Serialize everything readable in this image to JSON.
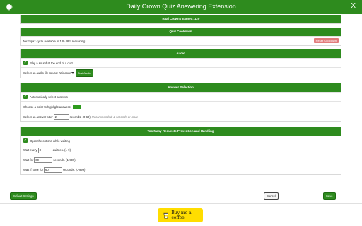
{
  "header": {
    "title": "Daily Crown Quiz Answering Extension",
    "close_label": "X"
  },
  "total_crowns": {
    "label": "Total Crowns Earned: 120"
  },
  "quiz_cooldown": {
    "heading": "Quiz Cooldown",
    "status_text": "Next quiz cycle available in 18h 48m remaining",
    "reset_label": "Reset Cooldown"
  },
  "audio": {
    "heading": "Audio",
    "play_sound_label": "Play a sound at the end of a quiz",
    "select_file_label": "Select an audio file to use:",
    "selected_file": "Windows",
    "test_label": "Test Audio"
  },
  "answer_selection": {
    "heading": "Answer Selection",
    "auto_select_label": "Automatically select answers",
    "color_label": "Choose a color to highlight answers:",
    "highlight_color": "#2e9b1e",
    "after_prefix": "Select an answer after",
    "after_value": "2",
    "after_suffix": "seconds. (0-60)",
    "after_hint": "Recommended: 2 seconds or more"
  },
  "too_many_requests": {
    "heading": "Too Many Requests Prevention and Handling",
    "open_options_label": "Open the options while waiting",
    "wait_every_prefix": "Wait every",
    "wait_every_value": "3",
    "wait_every_suffix": "quizzes. (1-9)",
    "wait_for_prefix": "Wait for",
    "wait_for_value": "60",
    "wait_for_suffix": "seconds. (1-999)",
    "wait_error_prefix": "Wait if Error for",
    "wait_error_value": "60",
    "wait_error_suffix": "seconds. (0-999)"
  },
  "footer": {
    "default_label": "Default Settings",
    "cancel_label": "Cancel",
    "save_label": "Save",
    "coffee_label": "Buy me a coffee"
  },
  "colors": {
    "accent": "#2e8b1e",
    "reset": "#e27b7b",
    "coffee": "#ffdd00"
  }
}
